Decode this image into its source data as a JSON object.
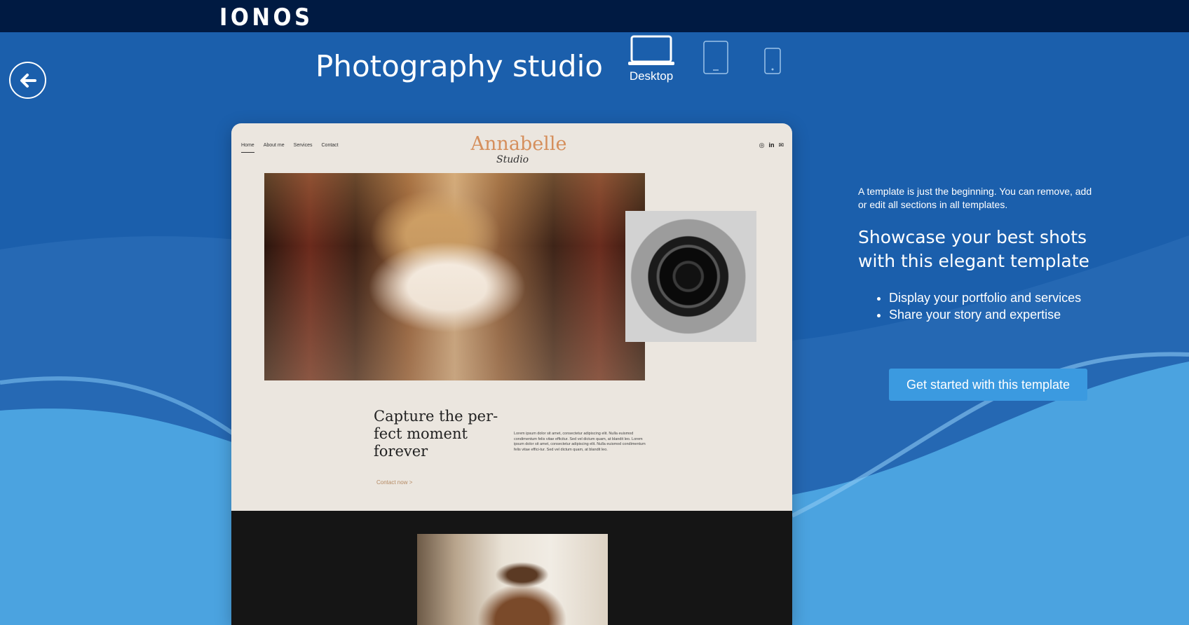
{
  "brand": {
    "logo_text": "IONOS"
  },
  "header": {
    "title": "Photography studio"
  },
  "devices": {
    "desktop_label": "Desktop",
    "selected": "desktop"
  },
  "preview": {
    "nav": [
      "Home",
      "About me",
      "Services",
      "Contact"
    ],
    "logo_main": "Annabelle",
    "logo_sub": "Studio",
    "heading": "Capture the per-fect moment forever",
    "body": "Lorem ipsum dolor sit amet, consectetur adipiscing elit. Nulla euismod condimentum felis vitae efficitur. Sed vel dictum quam, at blandit leo. Lorem ipsum dolor sit amet, consectetur adipiscing elit. Nulla euismod condimentum felis vitae effici-tur. Sed vel dictum quam, at blandit leo.",
    "cta": "Contact now >",
    "social_icons": [
      "instagram-icon",
      "linkedin-icon",
      "mail-icon"
    ]
  },
  "sidebar": {
    "note": "A template is just the beginning. You can remove, add or edit all sections in all templates.",
    "headline": "Showcase your best shots with this elegant template",
    "bullets": [
      "Display your portfolio and services",
      "Share your story and expertise"
    ],
    "cta_label": "Get started with this template"
  },
  "colors": {
    "topbar": "#001a42",
    "background": "#1b5fac",
    "button": "#3b9ae0"
  }
}
